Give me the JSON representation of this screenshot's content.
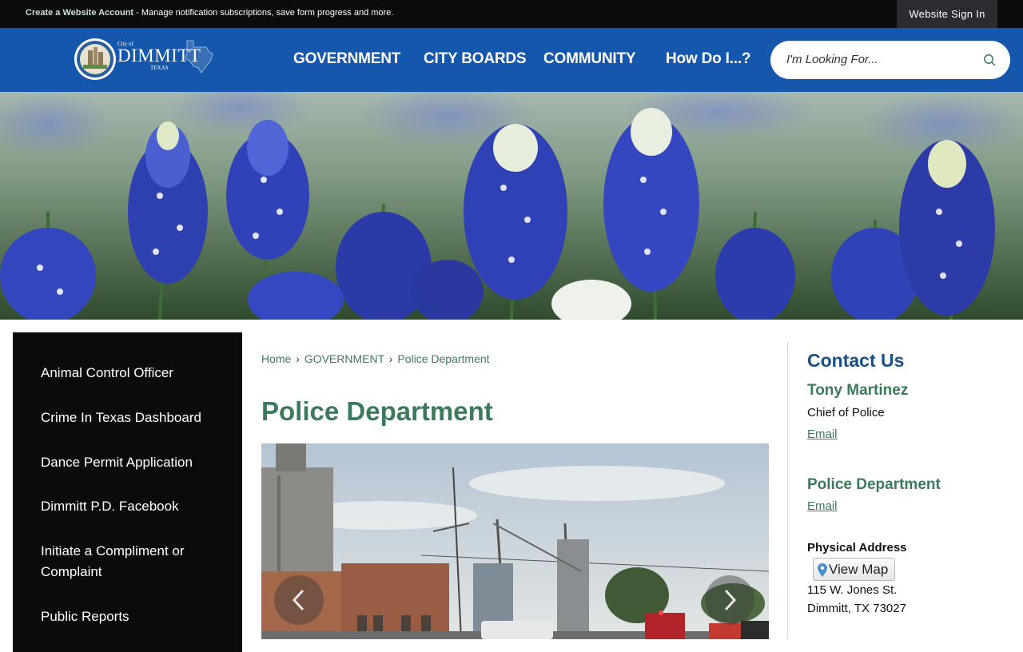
{
  "topbar": {
    "create_account_link": "Create a Website Account",
    "create_account_desc": " - Manage notification subscriptions, save form progress and more.",
    "sign_in": "Website Sign In"
  },
  "logo": {
    "small": "City of",
    "city": "DIMMITT",
    "state": "TEXAS"
  },
  "nav": {
    "items": [
      "GOVERNMENT",
      "CITY BOARDS",
      "COMMUNITY",
      "How Do I...?"
    ]
  },
  "search": {
    "placeholder": "I'm Looking For..."
  },
  "sidebar": {
    "items": [
      "Animal Control Officer",
      "Crime In Texas Dashboard",
      "Dance Permit Application",
      "Dimmitt P.D. Facebook",
      "Initiate a Compliment or Complaint",
      "Public Reports"
    ]
  },
  "breadcrumb": {
    "home": "Home",
    "section": "GOVERNMENT",
    "current": "Police Department",
    "separator": "›"
  },
  "page_title": "Police Department",
  "contact": {
    "title": "Contact Us",
    "person_name": "Tony Martinez",
    "person_role": "Chief of Police",
    "person_email": "Email",
    "dept_name": "Police Department",
    "dept_email": "Email",
    "address_label": "Physical Address",
    "view_map": "View Map",
    "address_line1": "115 W. Jones St.",
    "address_line2": "Dimmitt, TX 73027"
  },
  "colors": {
    "header_blue": "#1457ad",
    "accent_green": "#3b7a5a",
    "contact_blue": "#1b4f87",
    "dark": "#0b0b0d"
  }
}
